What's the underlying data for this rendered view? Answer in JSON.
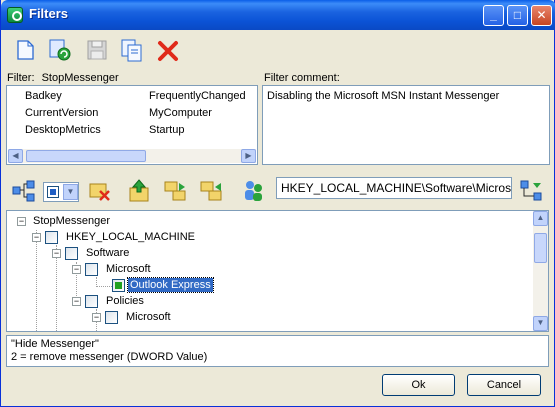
{
  "window": {
    "title": "Filters"
  },
  "toolbar1": {
    "icons": [
      "new-filter-icon",
      "refresh-icon",
      "save-icon",
      "copy-icon",
      "delete-icon"
    ]
  },
  "filter": {
    "label": "Filter:",
    "name": "StopMessenger",
    "items_col1": [
      "Badkey",
      "CurrentVersion",
      "DesktopMetrics"
    ],
    "items_col2": [
      "FrequentlyChanged",
      "MyComputer",
      "Startup"
    ]
  },
  "comment": {
    "label": "Filter comment:",
    "text": "Disabling the Microsoft MSN Instant Messenger"
  },
  "toolbar2": {
    "path": "HKEY_LOCAL_MACHINE\\Software\\Microsoft\\O"
  },
  "tree": {
    "nodes": [
      {
        "label": "StopMessenger"
      },
      {
        "label": "HKEY_LOCAL_MACHINE"
      },
      {
        "label": "Software"
      },
      {
        "label": "Microsoft"
      },
      {
        "label": "Outlook Express"
      },
      {
        "label": "Policies"
      },
      {
        "label": "Microsoft"
      }
    ]
  },
  "description": {
    "line1": "\"Hide Messenger\"",
    "line2": "2 = remove messenger (DWORD Value)"
  },
  "buttons": {
    "ok": "Ok",
    "cancel": "Cancel"
  }
}
